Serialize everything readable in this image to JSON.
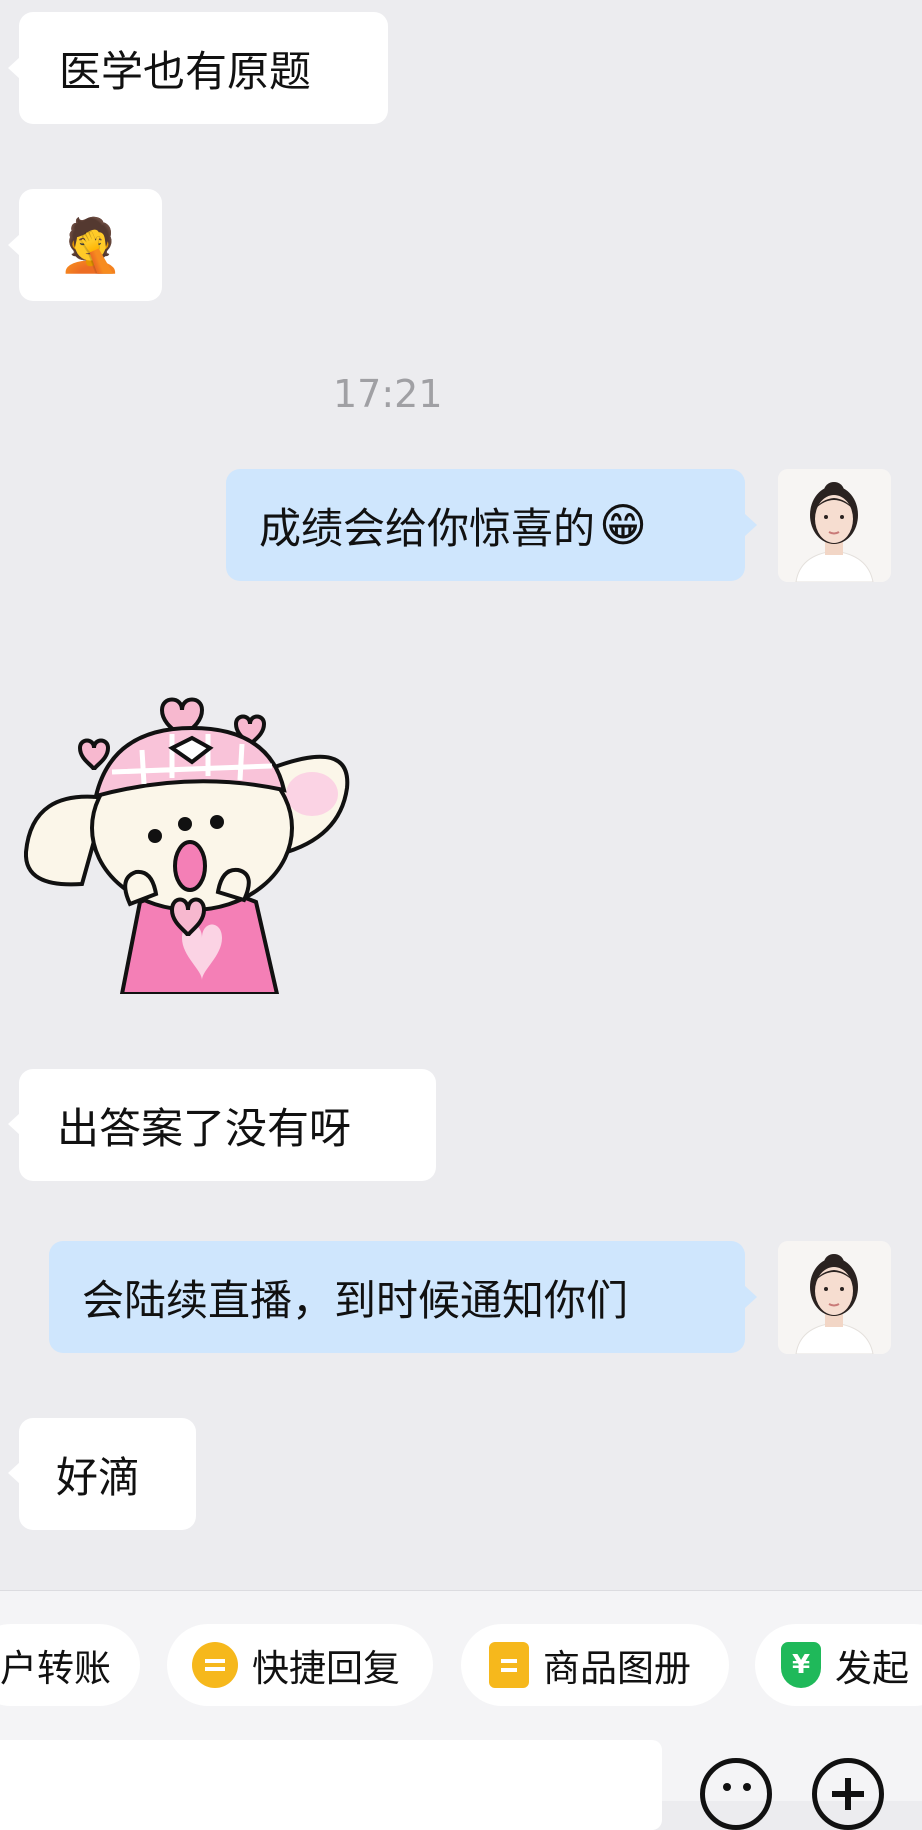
{
  "messages": {
    "m1": {
      "text": "医学也有原题"
    },
    "m2": {
      "emoji": "🤦"
    },
    "timestamp": "17:21",
    "m3": {
      "text": "成绩会给你惊喜的",
      "emoji": "😁"
    },
    "sticker": {
      "description_icon": "pink-hat-puppy-sticker"
    },
    "m4": {
      "text": "出答案了没有呀"
    },
    "m5": {
      "text": "会陆续直播，到时候通知你们"
    },
    "m6": {
      "text": "好滴"
    }
  },
  "toolbar": {
    "chips": [
      {
        "label": "户转账",
        "icon": "transfer-icon"
      },
      {
        "label": "快捷回复",
        "icon": "quick-reply-icon",
        "color": "#f6b81c"
      },
      {
        "label": "商品图册",
        "icon": "catalog-icon",
        "color": "#f6b81c"
      },
      {
        "label": "发起",
        "icon": "payment-icon",
        "color": "#1fb95a",
        "glyph": "¥"
      }
    ]
  },
  "colors": {
    "background": "#ececef",
    "incoming_bubble": "#ffffff",
    "outgoing_bubble": "#cfe6fd"
  }
}
